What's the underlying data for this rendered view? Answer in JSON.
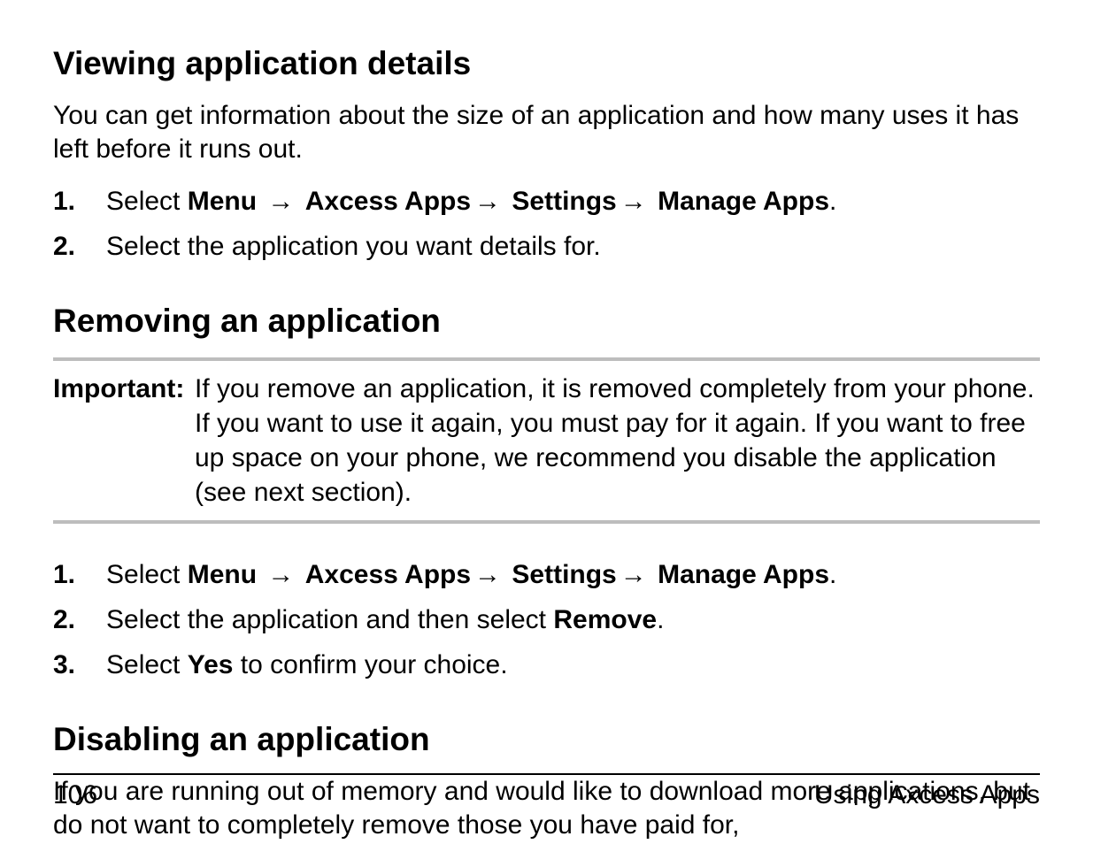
{
  "arrow": "→",
  "section1": {
    "heading": "Viewing application details",
    "intro": "You can get information about the size of an application and how many uses it has left before it runs out.",
    "steps": {
      "s1": {
        "num": "1.",
        "pre": "Select ",
        "p1": "Menu",
        "p2": "Axcess Apps",
        "p3": "Settings",
        "p4": "Manage Apps",
        "post": "."
      },
      "s2": {
        "num": "2.",
        "text": "Select the application you want details for."
      }
    }
  },
  "section2": {
    "heading": "Removing an application",
    "note": {
      "label": "Important:",
      "text": "If you remove an application, it is removed completely from your phone. If you want to use it again, you must pay for it again. If you want to free up space on your phone, we recommend you disable the application (see next section)."
    },
    "steps": {
      "s1": {
        "num": "1.",
        "pre": "Select ",
        "p1": "Menu",
        "p2": "Axcess Apps",
        "p3": "Settings",
        "p4": "Manage Apps",
        "post": "."
      },
      "s2": {
        "num": "2.",
        "pre": "Select the application and then select ",
        "b": "Remove",
        "post": "."
      },
      "s3": {
        "num": "3.",
        "pre": "Select ",
        "b": "Yes",
        "post": " to confirm your choice."
      }
    }
  },
  "section3": {
    "heading": "Disabling an application",
    "intro": "If you are running out of memory and would like to download more applications, but do not want to completely remove those you have paid for,"
  },
  "footer": {
    "pageNum": "106",
    "chapter": "Using Axcess Apps"
  }
}
